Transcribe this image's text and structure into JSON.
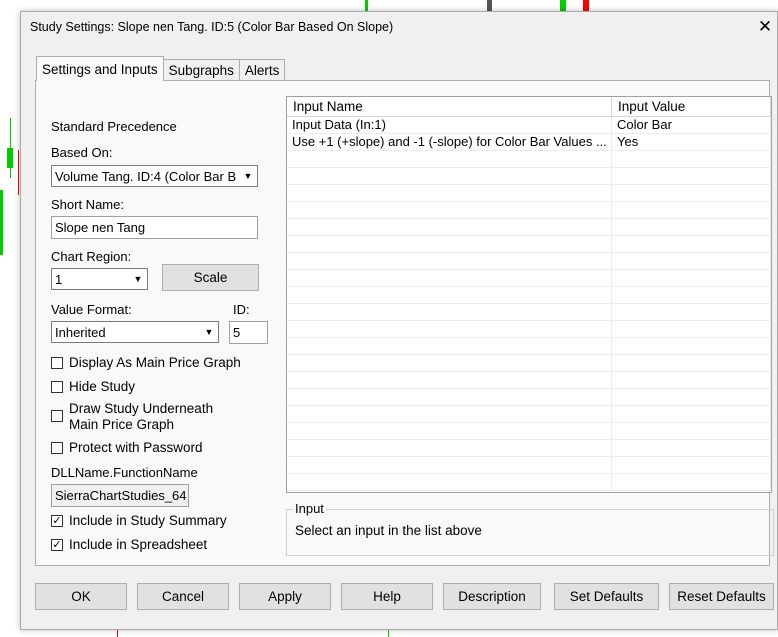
{
  "dialog": {
    "title": "Study Settings: Slope nen Tang. ID:5 (Color Bar Based On Slope)",
    "close_glyph": "✕"
  },
  "tabs": [
    {
      "label": "Settings and Inputs",
      "active": true
    },
    {
      "label": "Subgraphs",
      "active": false
    },
    {
      "label": "Alerts",
      "active": false
    }
  ],
  "left": {
    "standard_precedence": "Standard Precedence",
    "based_on_label": "Based On:",
    "based_on_value": "Volume Tang. ID:4 (Color Bar B",
    "short_name_label": "Short Name:",
    "short_name_value": "Slope nen Tang",
    "chart_region_label": "Chart Region:",
    "chart_region_value": "1",
    "scale_label": "Scale",
    "value_format_label": "Value Format:",
    "value_format_value": "Inherited",
    "id_label": "ID:",
    "id_value": "5",
    "display_main": "Display As Main Price Graph",
    "hide_study": "Hide Study",
    "draw_underneath_1": "Draw Study Underneath",
    "draw_underneath_2": "Main Price Graph",
    "protect_password": "Protect with Password",
    "dll_label": "DLLName.FunctionName",
    "dll_value": "SierraChartStudies_64",
    "include_summary": "Include in Study Summary",
    "include_spreadsheet": "Include in Spreadsheet",
    "checked_glyph": "✓"
  },
  "inputs_table": {
    "headers": [
      "Input Name",
      "Input Value"
    ],
    "rows": [
      [
        "Input Data   (In:1)",
        "Color Bar"
      ],
      [
        "Use +1 (+slope) and -1 (-slope) for Color Bar Values ...",
        "Yes"
      ]
    ]
  },
  "input_group": {
    "legend": "Input",
    "text": "Select an input in the list above"
  },
  "buttons": {
    "ok": "OK",
    "cancel": "Cancel",
    "apply": "Apply",
    "help": "Help",
    "description": "Description",
    "set_defaults": "Set Defaults",
    "reset_defaults": "Reset Defaults"
  },
  "colors": {
    "candle_up": "#00cc00",
    "candle_down": "#ff0000"
  }
}
